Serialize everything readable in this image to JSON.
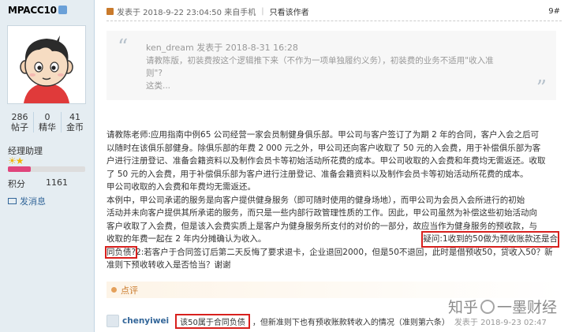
{
  "user": {
    "name": "MPACC10",
    "stats": [
      {
        "num": "286",
        "label": "帖子"
      },
      {
        "num": "0",
        "label": "精华"
      },
      {
        "num": "41",
        "label": "金币"
      }
    ],
    "role": "经理助理",
    "points_label": "积分",
    "points_value": "1161",
    "message_label": "发消息",
    "level_fraction": 0.3
  },
  "post": {
    "meta": "发表于 2018-9-22 23:04:50 来自手机",
    "only_author": "只看该作者",
    "floor": "9#"
  },
  "quote": {
    "author": "ken_dream 发表于 2018-8-31 16:28",
    "lines": [
      "请教陈版，初装费按这个逻辑推下来（不作为一项单独履约义务），初装费的业务不适用\"收入准",
      "则\"?",
      "这类..."
    ]
  },
  "body": {
    "line1": "请教陈老师:应用指南中例65 公司经营一家会员制健身俱乐部。甲公司与客户签订了为期 2 年的合同，客户入会之后可",
    "line2": "以随时在该俱乐部健身。除俱乐部的年费 2 000 元之外，甲公司还向客户收取了 50 元的入会费，用于补偿俱乐部为客",
    "line3": "户进行注册登记、准备会籍资料以及制作会员卡等初始活动所花费的成本。甲公司收取的入会费和年费均无需返还。收取",
    "line4": "了 50 元的入会费，用于补偿俱乐部为客户进行注册登记、准备会籍资料以及制作会员卡等初始活动所花费的成本。",
    "line5": "甲公司收取的入会费和年费均无需返还。",
    "line6": "本例中，甲公司承诺的服务是向客户提供健身服务（即可随时使用的健身场地），而甲公司为会员入会所进行的初始",
    "line7": "活动并未向客户提供其所承诺的服务，而只是一些内部行政管理性质的工作。因此，甲公司虽然为补偿这些初始活动向",
    "line8": "客户收取了入会费，但是该入会费实质上是客户为健身服务所支付的对价的一部分，故应当作为健身服务的预收款，与",
    "line9a": "收取的年费一起在 2 年内分摊确认为收入。",
    "line9b": "疑问:1收到的50做为预收账款还是合",
    "line10a": "同负债?",
    "line10b": "2:若客户于合同签订后第二天反悔了要求退卡，企业退回2000，但是50不退回，此时是借预收50，贷收入50？新",
    "line11": "准则下预收转收入是否恰当？谢谢"
  },
  "comment_section": {
    "label": "点评"
  },
  "comment": {
    "user": "chenyiwei",
    "highlight": "该50属于合同负债",
    "text": "，但新准则下也有预收账款转收入的情况（准则第六条）",
    "time": "发表于 2018-9-23 02:47"
  },
  "watermark": {
    "left": "知乎",
    "right": "一墨财经"
  }
}
